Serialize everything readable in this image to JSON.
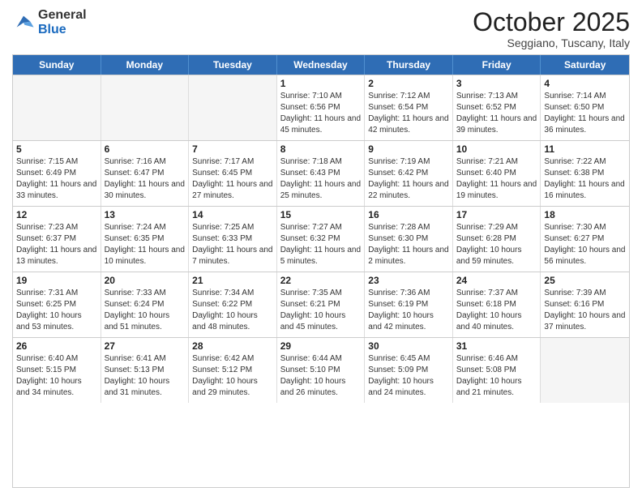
{
  "header": {
    "logo_general": "General",
    "logo_blue": "Blue",
    "month_title": "October 2025",
    "subtitle": "Seggiano, Tuscany, Italy"
  },
  "days_of_week": [
    "Sunday",
    "Monday",
    "Tuesday",
    "Wednesday",
    "Thursday",
    "Friday",
    "Saturday"
  ],
  "weeks": [
    [
      {
        "day": "",
        "detail": ""
      },
      {
        "day": "",
        "detail": ""
      },
      {
        "day": "",
        "detail": ""
      },
      {
        "day": "1",
        "detail": "Sunrise: 7:10 AM\nSunset: 6:56 PM\nDaylight: 11 hours and 45 minutes."
      },
      {
        "day": "2",
        "detail": "Sunrise: 7:12 AM\nSunset: 6:54 PM\nDaylight: 11 hours and 42 minutes."
      },
      {
        "day": "3",
        "detail": "Sunrise: 7:13 AM\nSunset: 6:52 PM\nDaylight: 11 hours and 39 minutes."
      },
      {
        "day": "4",
        "detail": "Sunrise: 7:14 AM\nSunset: 6:50 PM\nDaylight: 11 hours and 36 minutes."
      }
    ],
    [
      {
        "day": "5",
        "detail": "Sunrise: 7:15 AM\nSunset: 6:49 PM\nDaylight: 11 hours and 33 minutes."
      },
      {
        "day": "6",
        "detail": "Sunrise: 7:16 AM\nSunset: 6:47 PM\nDaylight: 11 hours and 30 minutes."
      },
      {
        "day": "7",
        "detail": "Sunrise: 7:17 AM\nSunset: 6:45 PM\nDaylight: 11 hours and 27 minutes."
      },
      {
        "day": "8",
        "detail": "Sunrise: 7:18 AM\nSunset: 6:43 PM\nDaylight: 11 hours and 25 minutes."
      },
      {
        "day": "9",
        "detail": "Sunrise: 7:19 AM\nSunset: 6:42 PM\nDaylight: 11 hours and 22 minutes."
      },
      {
        "day": "10",
        "detail": "Sunrise: 7:21 AM\nSunset: 6:40 PM\nDaylight: 11 hours and 19 minutes."
      },
      {
        "day": "11",
        "detail": "Sunrise: 7:22 AM\nSunset: 6:38 PM\nDaylight: 11 hours and 16 minutes."
      }
    ],
    [
      {
        "day": "12",
        "detail": "Sunrise: 7:23 AM\nSunset: 6:37 PM\nDaylight: 11 hours and 13 minutes."
      },
      {
        "day": "13",
        "detail": "Sunrise: 7:24 AM\nSunset: 6:35 PM\nDaylight: 11 hours and 10 minutes."
      },
      {
        "day": "14",
        "detail": "Sunrise: 7:25 AM\nSunset: 6:33 PM\nDaylight: 11 hours and 7 minutes."
      },
      {
        "day": "15",
        "detail": "Sunrise: 7:27 AM\nSunset: 6:32 PM\nDaylight: 11 hours and 5 minutes."
      },
      {
        "day": "16",
        "detail": "Sunrise: 7:28 AM\nSunset: 6:30 PM\nDaylight: 11 hours and 2 minutes."
      },
      {
        "day": "17",
        "detail": "Sunrise: 7:29 AM\nSunset: 6:28 PM\nDaylight: 10 hours and 59 minutes."
      },
      {
        "day": "18",
        "detail": "Sunrise: 7:30 AM\nSunset: 6:27 PM\nDaylight: 10 hours and 56 minutes."
      }
    ],
    [
      {
        "day": "19",
        "detail": "Sunrise: 7:31 AM\nSunset: 6:25 PM\nDaylight: 10 hours and 53 minutes."
      },
      {
        "day": "20",
        "detail": "Sunrise: 7:33 AM\nSunset: 6:24 PM\nDaylight: 10 hours and 51 minutes."
      },
      {
        "day": "21",
        "detail": "Sunrise: 7:34 AM\nSunset: 6:22 PM\nDaylight: 10 hours and 48 minutes."
      },
      {
        "day": "22",
        "detail": "Sunrise: 7:35 AM\nSunset: 6:21 PM\nDaylight: 10 hours and 45 minutes."
      },
      {
        "day": "23",
        "detail": "Sunrise: 7:36 AM\nSunset: 6:19 PM\nDaylight: 10 hours and 42 minutes."
      },
      {
        "day": "24",
        "detail": "Sunrise: 7:37 AM\nSunset: 6:18 PM\nDaylight: 10 hours and 40 minutes."
      },
      {
        "day": "25",
        "detail": "Sunrise: 7:39 AM\nSunset: 6:16 PM\nDaylight: 10 hours and 37 minutes."
      }
    ],
    [
      {
        "day": "26",
        "detail": "Sunrise: 6:40 AM\nSunset: 5:15 PM\nDaylight: 10 hours and 34 minutes."
      },
      {
        "day": "27",
        "detail": "Sunrise: 6:41 AM\nSunset: 5:13 PM\nDaylight: 10 hours and 31 minutes."
      },
      {
        "day": "28",
        "detail": "Sunrise: 6:42 AM\nSunset: 5:12 PM\nDaylight: 10 hours and 29 minutes."
      },
      {
        "day": "29",
        "detail": "Sunrise: 6:44 AM\nSunset: 5:10 PM\nDaylight: 10 hours and 26 minutes."
      },
      {
        "day": "30",
        "detail": "Sunrise: 6:45 AM\nSunset: 5:09 PM\nDaylight: 10 hours and 24 minutes."
      },
      {
        "day": "31",
        "detail": "Sunrise: 6:46 AM\nSunset: 5:08 PM\nDaylight: 10 hours and 21 minutes."
      },
      {
        "day": "",
        "detail": ""
      }
    ]
  ]
}
